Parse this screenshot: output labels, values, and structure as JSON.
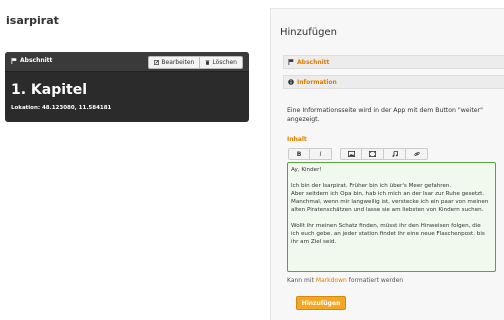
{
  "app": {
    "title": "isarpirat"
  },
  "chapter": {
    "section_label": "Abschnitt",
    "edit_label": "Bearbeiten",
    "delete_label": "Löschen",
    "title": "1. Kapitel",
    "location": "Lokation: 48.123080, 11.584181"
  },
  "panel": {
    "title": "Hinzufügen",
    "section_abschnitt": "Abschnitt",
    "section_information": "Information",
    "info_text": "Eine Informationsseite wird in der App mit dem Button \"weiter\" angezeigt.",
    "inhalt_label": "Inhalt",
    "toolbar": {
      "bold": "B",
      "italic": "I"
    },
    "editor_lines": [
      "Ay, Kinder!",
      "",
      "Ich bin der Isarpirat. Früher bin ich über's Meer gefahren.",
      "Aber seitdem ich Opa bin, hab ich mich an der Isar zur Ruhe gesetzt.",
      "Manchmal, wenn mir langweilig ist, verstecke ich ein paar von meinen",
      "alten Piratenschätzen und lasse sie am liebsten von Kindern suchen.",
      "",
      "Wollt ihr meinen Schatz finden, müsst ihr den Hinweisen folgen, die",
      "ich euch gebe. an jeder station findet ihr eine neue Flaschenpost. bis",
      "ihr am Ziel seid."
    ],
    "md_hint_prefix": "Kann mit",
    "md_hint_link": "Markdown",
    "md_hint_suffix": "formatiert werden",
    "submit_label": "Hinzufügen"
  },
  "colors": {
    "accent": "#e07b00",
    "button": "#f5a623",
    "editor_border": "#5aa04a",
    "card_bg": "#2b2b2b"
  }
}
